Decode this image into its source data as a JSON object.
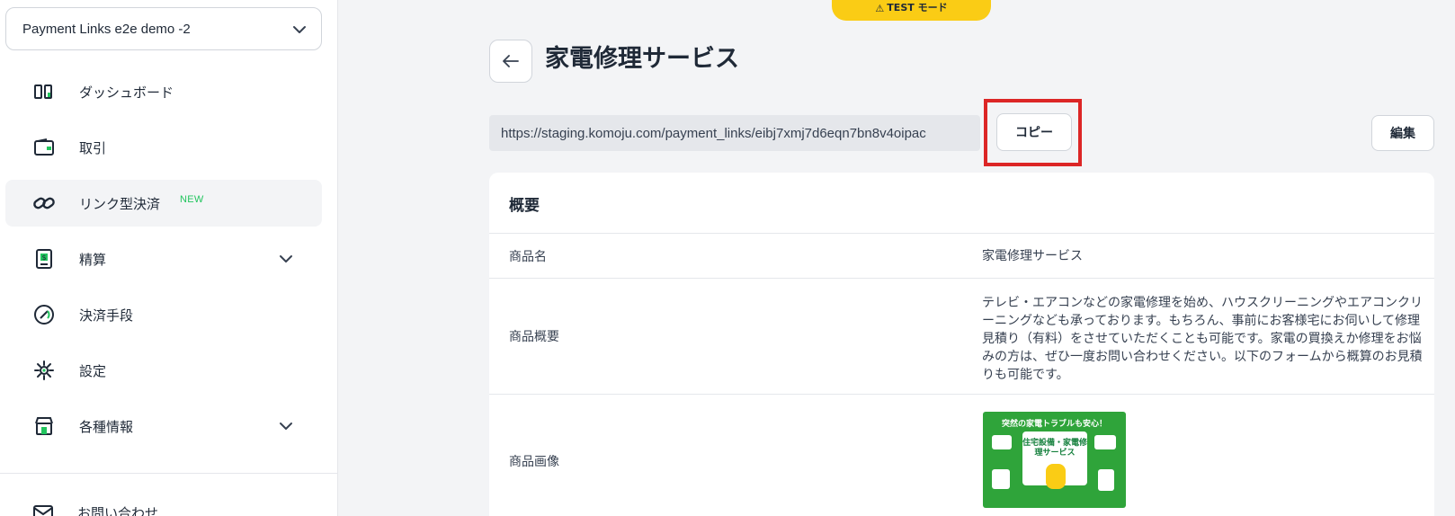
{
  "sidebar": {
    "account_name": "Payment Links e2e demo -2",
    "items": [
      {
        "label": "ダッシュボード",
        "icon": "dashboard-icon"
      },
      {
        "label": "取引",
        "icon": "wallet-icon"
      },
      {
        "label": "リンク型決済",
        "icon": "link-icon",
        "badge": "NEW",
        "active": true
      },
      {
        "label": "精算",
        "icon": "invoice-dollar-icon",
        "expandable": true
      },
      {
        "label": "決済手段",
        "icon": "payment-methods-icon"
      },
      {
        "label": "設定",
        "icon": "gear-icon"
      },
      {
        "label": "各種情報",
        "icon": "store-icon",
        "expandable": true
      }
    ],
    "partial_item": {
      "label": "お問い合わせ",
      "icon": "mail-icon"
    }
  },
  "test_mode": {
    "label": "TEST モード"
  },
  "header": {
    "title": "家電修理サービス"
  },
  "link": {
    "url": "https://staging.komoju.com/payment_links/eibj7xmj7d6eqn7bn8v4oipac",
    "copy_label": "コピー",
    "edit_label": "編集"
  },
  "overview": {
    "title": "概要",
    "rows": [
      {
        "key": "商品名",
        "value": "家電修理サービス"
      },
      {
        "key": "商品概要",
        "value": "テレビ・エアコンなどの家電修理を始め、ハウスクリーニングやエアコンクリーニングなども承っております。もちろん、事前にお客様宅にお伺いして修理見積り（有料）をさせていただくことも可能です。家電の買換えか修理をお悩みの方は、ぜひ一度お問い合わせください。以下のフォームから概算のお見積りも可能です。"
      },
      {
        "key": "商品画像",
        "value": ""
      }
    ],
    "image_text": {
      "headline": "突然の家電トラブルも安心！",
      "title": "住宅設備・家電修理サービス"
    }
  },
  "colors": {
    "test_mode": "#facc15",
    "highlight": "#dc2626",
    "badge_new": "#22c55e",
    "image_green": "#2fa43a"
  }
}
